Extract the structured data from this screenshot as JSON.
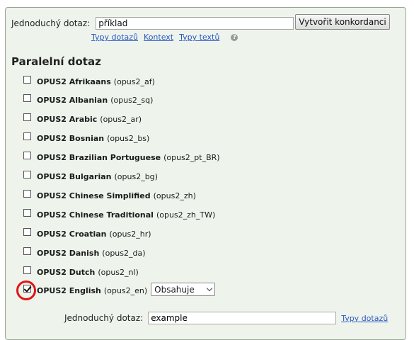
{
  "simple_query": {
    "label": "Jednoduchý dotaz:",
    "value": "příklad",
    "button": "Vytvořit konkordanci"
  },
  "links": [
    "Typy dotazů",
    "Kontext",
    "Typy textů"
  ],
  "help_icon": "question-icon",
  "parallel": {
    "title": "Paralelní dotaz",
    "languages": [
      {
        "name": "OPUS2 Afrikaans",
        "code": "(opus2_af)",
        "checked": false
      },
      {
        "name": "OPUS2 Albanian",
        "code": "(opus2_sq)",
        "checked": false
      },
      {
        "name": "OPUS2 Arabic",
        "code": "(opus2_ar)",
        "checked": false
      },
      {
        "name": "OPUS2 Bosnian",
        "code": "(opus2_bs)",
        "checked": false
      },
      {
        "name": "OPUS2 Brazilian Portuguese",
        "code": "(opus2_pt_BR)",
        "checked": false
      },
      {
        "name": "OPUS2 Bulgarian",
        "code": "(opus2_bg)",
        "checked": false
      },
      {
        "name": "OPUS2 Chinese Simplified",
        "code": "(opus2_zh)",
        "checked": false
      },
      {
        "name": "OPUS2 Chinese Traditional",
        "code": "(opus2_zh_TW)",
        "checked": false
      },
      {
        "name": "OPUS2 Croatian",
        "code": "(opus2_hr)",
        "checked": false
      },
      {
        "name": "OPUS2 Danish",
        "code": "(opus2_da)",
        "checked": false
      },
      {
        "name": "OPUS2 Dutch",
        "code": "(opus2_nl)",
        "checked": false
      },
      {
        "name": "OPUS2 English",
        "code": "(opus2_en)",
        "checked": true
      }
    ],
    "english_filter": "Obsahuje",
    "sub_query": {
      "label": "Jednoduchý dotaz:",
      "value": "example",
      "link": "Typy dotazů"
    }
  },
  "colors": {
    "panel_bg": "#eef4ec",
    "link": "#2a55c2",
    "highlight": "#e01616"
  }
}
